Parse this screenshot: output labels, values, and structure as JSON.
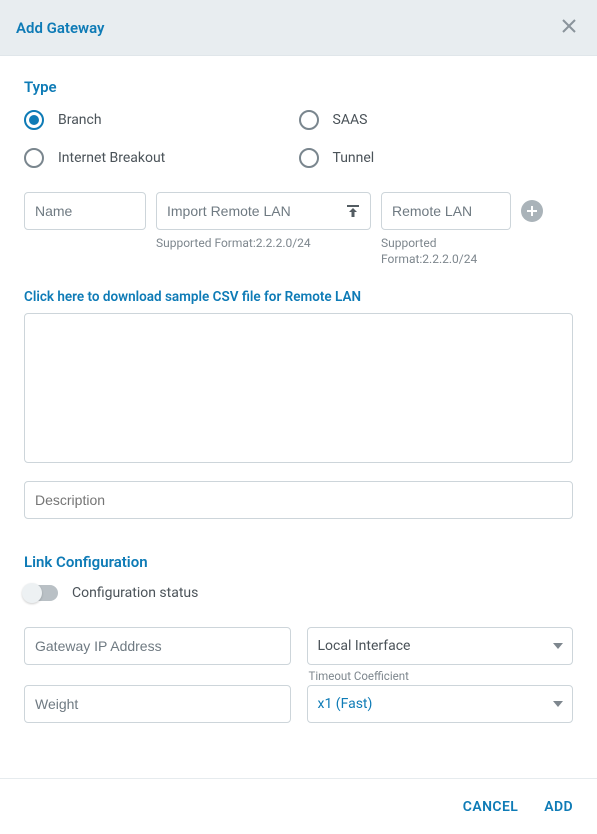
{
  "header": {
    "title": "Add Gateway"
  },
  "type_section": {
    "title": "Type",
    "options": [
      {
        "label": "Branch",
        "selected": true
      },
      {
        "label": "SAAS",
        "selected": false
      },
      {
        "label": "Internet Breakout",
        "selected": false
      },
      {
        "label": "Tunnel",
        "selected": false
      }
    ]
  },
  "fields": {
    "name": {
      "placeholder": "Name"
    },
    "import_remote_lan": {
      "placeholder": "Import Remote LAN",
      "hint": "Supported Format:2.2.2.0/24"
    },
    "remote_lan": {
      "placeholder": "Remote LAN",
      "hint": "Supported Format:2.2.2.0/24"
    },
    "download_link": {
      "click_here": "Click here",
      "rest": " to download sample CSV file for Remote LAN"
    },
    "description": {
      "placeholder": "Description"
    }
  },
  "link_config": {
    "title": "Link Configuration",
    "config_status_label": "Configuration status",
    "gateway_ip": {
      "placeholder": "Gateway IP Address"
    },
    "local_interface": {
      "placeholder": "Local Interface"
    },
    "weight": {
      "placeholder": "Weight"
    },
    "timeout": {
      "label": "Timeout Coefficient",
      "value": "x1 (Fast)"
    }
  },
  "footer": {
    "cancel": "CANCEL",
    "add": "ADD"
  }
}
